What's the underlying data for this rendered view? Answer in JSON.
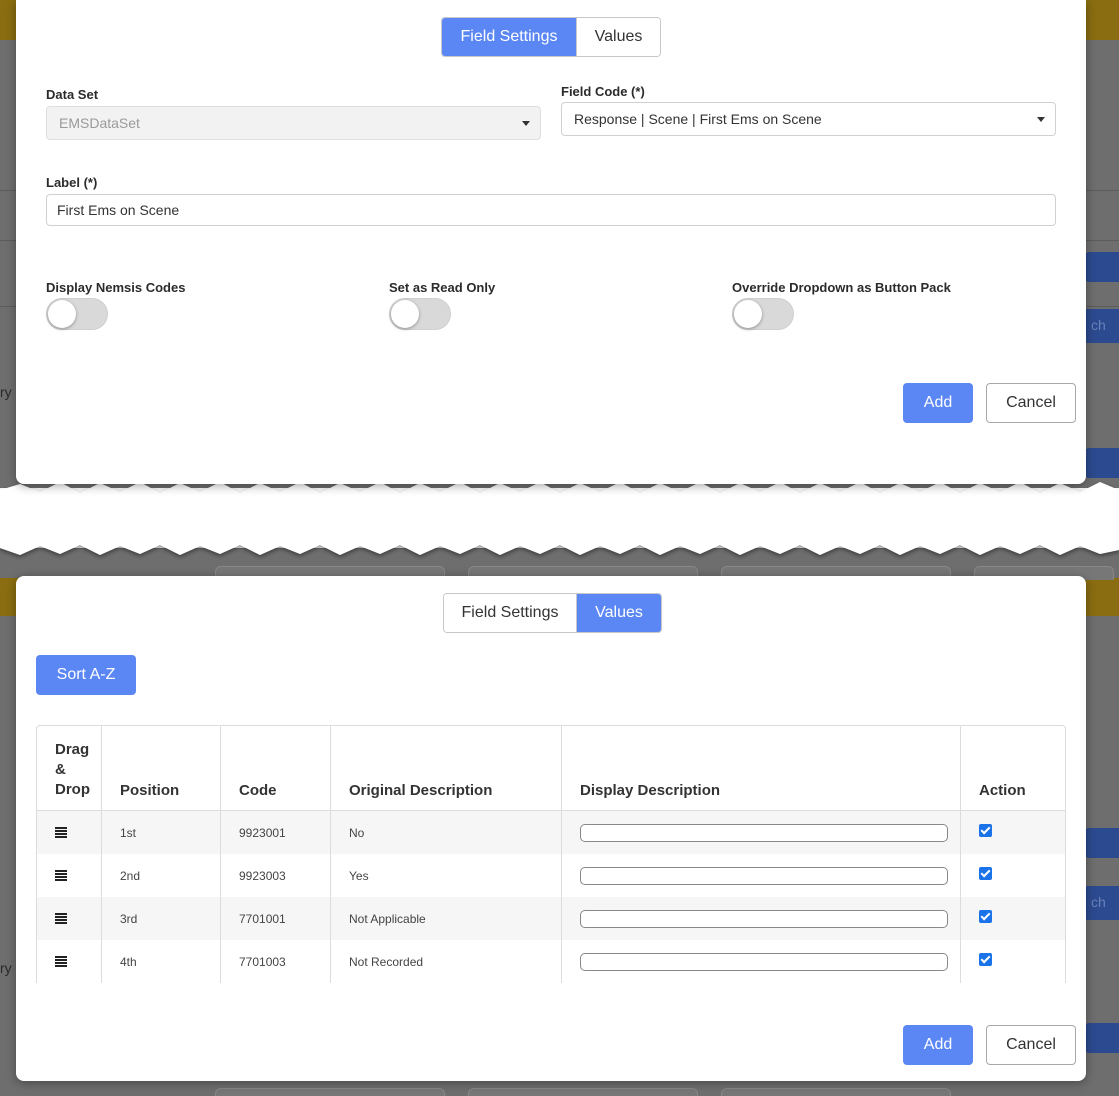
{
  "tabs": {
    "field_settings": "Field Settings",
    "values": "Values"
  },
  "field_settings": {
    "data_set": {
      "label": "Data Set",
      "value": "EMSDataSet"
    },
    "field_code": {
      "label": "Field Code (*)",
      "value": "Response | Scene | First Ems on Scene"
    },
    "label_field": {
      "label": "Label (*)",
      "value": "First Ems on Scene"
    },
    "toggles": {
      "display_nemsis": {
        "label": "Display Nemsis Codes",
        "on": false
      },
      "read_only": {
        "label": "Set as Read Only",
        "on": false
      },
      "override_dropdown": {
        "label": "Override Dropdown as Button Pack",
        "on": false
      }
    },
    "add_label": "Add",
    "cancel_label": "Cancel"
  },
  "values_tab": {
    "sort_label": "Sort A-Z",
    "columns": {
      "drag_l1": "Drag",
      "drag_l2": "&",
      "drag_l3": "Drop",
      "position": "Position",
      "code": "Code",
      "original": "Original Description",
      "display": "Display Description",
      "action": "Action"
    },
    "rows": [
      {
        "position": "1st",
        "code": "9923001",
        "original": "No",
        "display": "",
        "checked": true
      },
      {
        "position": "2nd",
        "code": "9923003",
        "original": "Yes",
        "display": "",
        "checked": true
      },
      {
        "position": "3rd",
        "code": "7701001",
        "original": "Not Applicable",
        "display": "",
        "checked": true
      },
      {
        "position": "4th",
        "code": "7701003",
        "original": "Not Recorded",
        "display": "",
        "checked": true
      }
    ],
    "add_label": "Add",
    "cancel_label": "Cancel"
  },
  "background": {
    "left_fragment": "ry",
    "right_fragment": "ch"
  },
  "colors": {
    "accent": "#5b87f5",
    "checkbox": "#1a73e8",
    "header_bar": "#8a6d10"
  }
}
